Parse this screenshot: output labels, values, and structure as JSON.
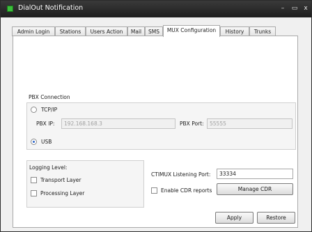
{
  "window": {
    "title": "DialOut Notification",
    "controls": {
      "minimize": "–",
      "maximize": "▭",
      "close": "x"
    }
  },
  "tabs": [
    {
      "label": "Admin Login",
      "active": false
    },
    {
      "label": "Stations",
      "active": false
    },
    {
      "label": "Users Action",
      "active": false
    },
    {
      "label": "Mail",
      "active": false
    },
    {
      "label": "SMS",
      "active": false
    },
    {
      "label": "MUX Configuration",
      "active": true
    },
    {
      "label": "History",
      "active": false
    },
    {
      "label": "Trunks",
      "active": false
    }
  ],
  "pbx_connection": {
    "group_label": "PBX Connection",
    "tcpip_label": "TCP/IP",
    "tcpip_selected": false,
    "pbx_ip_label": "PBX IP:",
    "pbx_ip_value": "192.168.168.3",
    "pbx_port_label": "PBX Port:",
    "pbx_port_value": "55555",
    "usb_label": "USB",
    "usb_selected": true
  },
  "logging": {
    "group_label": "Logging Level:",
    "transport_label": "Transport Layer",
    "transport_checked": false,
    "processing_label": "Processing Layer",
    "processing_checked": false
  },
  "ctimux": {
    "listening_port_label": "CTIMUX Listening Port:",
    "listening_port_value": "33334",
    "cdr_label": "Enable CDR reports",
    "cdr_checked": false,
    "manage_cdr_label": "Manage CDR"
  },
  "actions": {
    "apply_label": "Apply",
    "restore_label": "Restore"
  }
}
